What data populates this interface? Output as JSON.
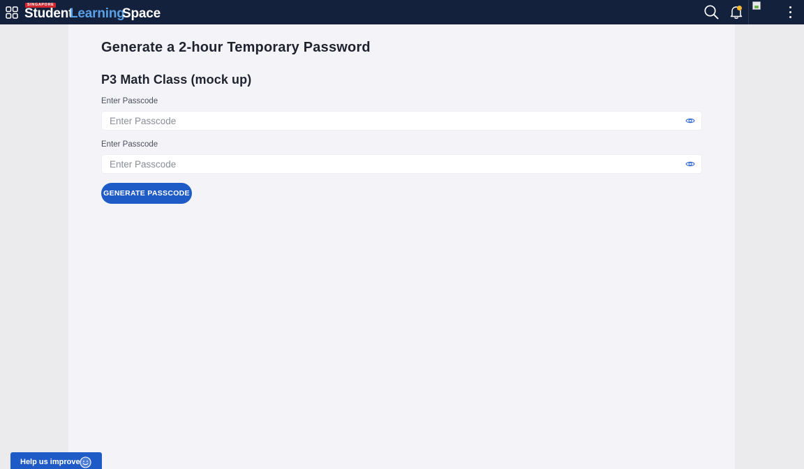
{
  "header": {
    "logo_tag": "SINGAPORE",
    "logo_word1": "Student",
    "logo_word2": "Learning",
    "logo_word3": "Space",
    "icons": [
      "apps-grid-icon",
      "search-icon",
      "bell-icon",
      "avatar-image",
      "more-vertical-icon"
    ],
    "notification_dot_color": "#f5b82e"
  },
  "page": {
    "title": "Generate a 2-hour Temporary Password",
    "class_name": "P3 Math Class (mock up)",
    "fields": [
      {
        "label": "Enter Passcode",
        "placeholder": "Enter Passcode",
        "value": ""
      },
      {
        "label": "Enter Passcode",
        "placeholder": "Enter Passcode",
        "value": ""
      }
    ],
    "generate_button": "GENERATE PASSCODE"
  },
  "feedback": {
    "label": "Help us improve"
  },
  "colors": {
    "topbar": "#14213d",
    "accent": "#1f5bc6",
    "logo_blue": "#5aa0e6"
  }
}
